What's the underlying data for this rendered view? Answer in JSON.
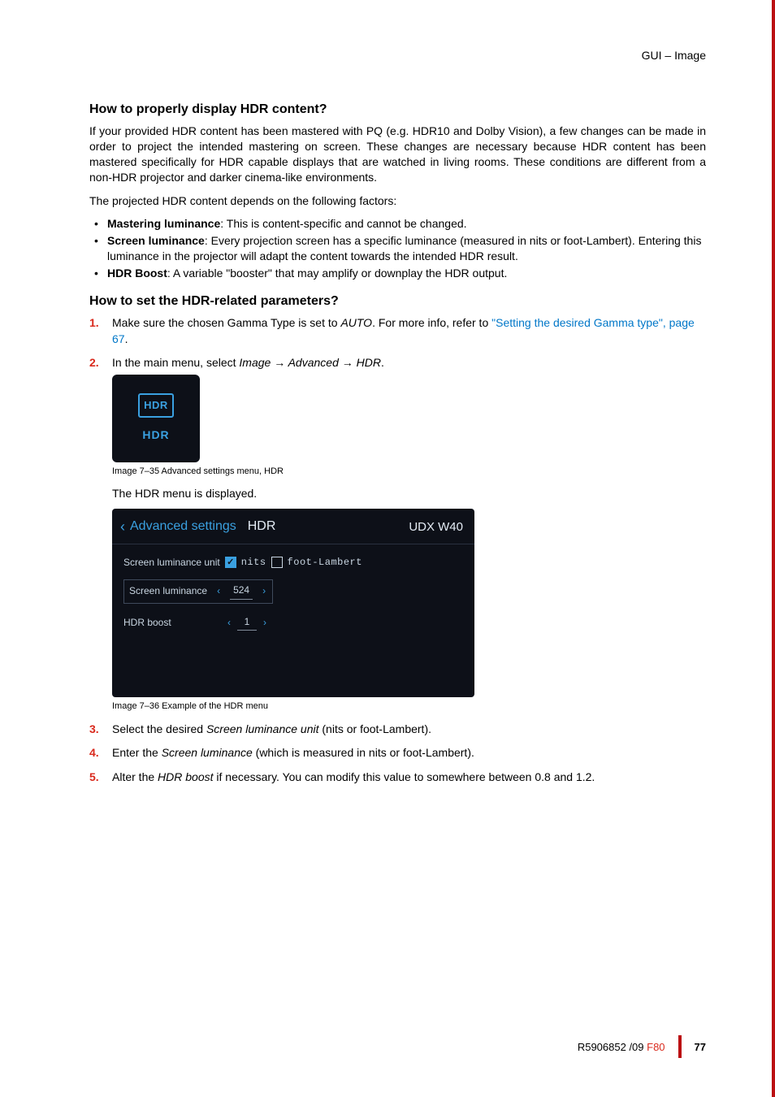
{
  "header": {
    "breadcrumb": "GUI – Image"
  },
  "section1": {
    "heading": "How to properly display HDR content?",
    "p1": "If your provided HDR content has been mastered with PQ (e.g. HDR10 and Dolby Vision), a few changes can be made in order to project the intended mastering on screen. These changes are necessary because HDR content has been mastered specifically for HDR capable displays that are watched in living rooms. These conditions are different from a non-HDR projector and darker cinema-like environments.",
    "p2": "The projected HDR content depends on the following factors:",
    "bullets": [
      {
        "strong": "Mastering luminance",
        "rest": ": This is content-specific and cannot be changed."
      },
      {
        "strong": "Screen luminance",
        "rest": ": Every projection screen has a specific luminance (measured in nits or foot-Lambert). Entering this luminance in the projector will adapt the content towards the intended HDR result."
      },
      {
        "strong": "HDR Boost",
        "rest": ": A variable \"booster\" that may amplify or downplay the HDR output."
      }
    ]
  },
  "section2": {
    "heading": "How to set the HDR-related parameters?",
    "step1_a": "Make sure the chosen Gamma Type is set to ",
    "step1_auto": "AUTO",
    "step1_b": ". For more info, refer to ",
    "step1_link": "\"Setting the desired Gamma type\", page 67",
    "step1_c": ".",
    "step2_a": "In the main menu, select ",
    "step2_path": "Image → Advanced → HDR",
    "step2_b": ".",
    "tile_icon": "HDR",
    "tile_label": "HDR",
    "caption35": "Image 7–35   Advanced settings menu, HDR",
    "displayed": "The HDR menu is displayed.",
    "panel": {
      "back": "‹",
      "crumb": "Advanced settings",
      "title": "HDR",
      "model": "UDX W40",
      "row1_label": "Screen luminance unit",
      "row1_opt1": "nits",
      "row1_opt2": "foot-Lambert",
      "row2_label": "Screen luminance",
      "row2_value": "524",
      "row3_label": "HDR boost",
      "row3_value": "1",
      "lchev": "‹",
      "rchev": "›"
    },
    "caption36": "Image 7–36   Example of the HDR menu",
    "step3_a": "Select the desired ",
    "step3_i": "Screen luminance unit",
    "step3_b": " (nits or foot-Lambert).",
    "step4_a": "Enter the ",
    "step4_i": "Screen luminance",
    "step4_b": " (which is measured in nits or foot-Lambert).",
    "step5_a": "Alter the ",
    "step5_i": "HDR boost",
    "step5_b": " if necessary. You can modify this value to somewhere between 0.8 and 1.2."
  },
  "footer": {
    "doc": "R5906852 /09  ",
    "model": "F80",
    "page": "77"
  }
}
